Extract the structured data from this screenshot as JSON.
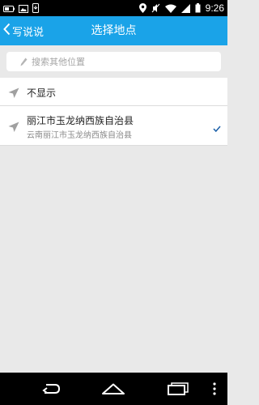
{
  "status_bar": {
    "time": "9:26",
    "left_icons": [
      "battery-percent-icon",
      "image-icon",
      "phone-download-icon"
    ],
    "right_icons": [
      "location-icon",
      "mute-icon",
      "wifi-icon",
      "signal-icon",
      "battery-icon"
    ]
  },
  "header": {
    "back_label": "写说说",
    "title": "选择地点",
    "background": "#1aa3e8"
  },
  "search": {
    "placeholder": "搜索其他位置"
  },
  "list": {
    "items": [
      {
        "title": "不显示",
        "subtitle": "",
        "selected": false,
        "icon": "location-arrow-icon"
      },
      {
        "title": "丽江市玉龙纳西族自治县",
        "subtitle": "云南丽江市玉龙纳西族自治县",
        "selected": true,
        "icon": "location-arrow-icon"
      }
    ]
  },
  "nav_bar": {
    "buttons": [
      "back-icon",
      "home-icon",
      "recent-apps-icon",
      "overflow-menu-icon"
    ]
  }
}
